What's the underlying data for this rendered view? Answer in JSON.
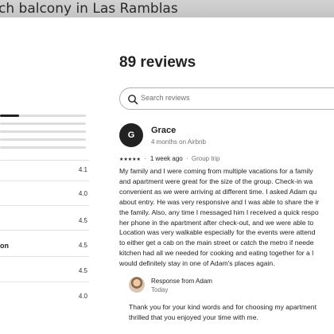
{
  "header": {
    "title": "ch balcony in Las Ramblas"
  },
  "ratings_panel": {
    "overall_bar_fraction": 0.22,
    "categories": [
      {
        "label": "",
        "score": "4.1"
      },
      {
        "label": "",
        "score": "4.0"
      },
      {
        "label": "",
        "score": "4.5"
      },
      {
        "label": "on",
        "score": "4.5"
      },
      {
        "label": "",
        "score": "4.5"
      },
      {
        "label": "",
        "score": "4.0"
      }
    ]
  },
  "reviews": {
    "heading": "89 reviews",
    "search_placeholder": "Search reviews",
    "items": [
      {
        "avatar_initial": "G",
        "name": "Grace",
        "meta": "4 months on Airbnb",
        "stars": "★★★★★",
        "when": "1 week ago",
        "trip_type": "Group trip",
        "body_lines": [
          "My family and I were coming from multiple vacations for a family",
          "and apartment were great for the size of the group. Check-in wa",
          "convenient as we were arriving at different time. I asked Adam qu",
          "about entry. He was very responsive and I was able to share the ir",
          "the family. Also, any time I messaged him I received a quick respo",
          "her phone in the apartment after check-out, and we were able to",
          "Location was very walkable especially for the events were attend",
          "to either get a cab on the main street or catch the metro if neede",
          "kitchen had all we needed for cooking and eating together for a l",
          "would definitely stay in one of Adam's places again."
        ],
        "response": {
          "from": "Response from Adam",
          "when": "Today",
          "body_lines": [
            "Thank you for your kind words and for choosing my apartment",
            "thrilled that you enjoyed your time with me."
          ]
        }
      }
    ]
  },
  "icons": {
    "search": "search-icon"
  },
  "colors": {
    "text": "#222222",
    "muted": "#717171",
    "border": "#b0b0b0",
    "titlebar": "#c8c8c8"
  }
}
